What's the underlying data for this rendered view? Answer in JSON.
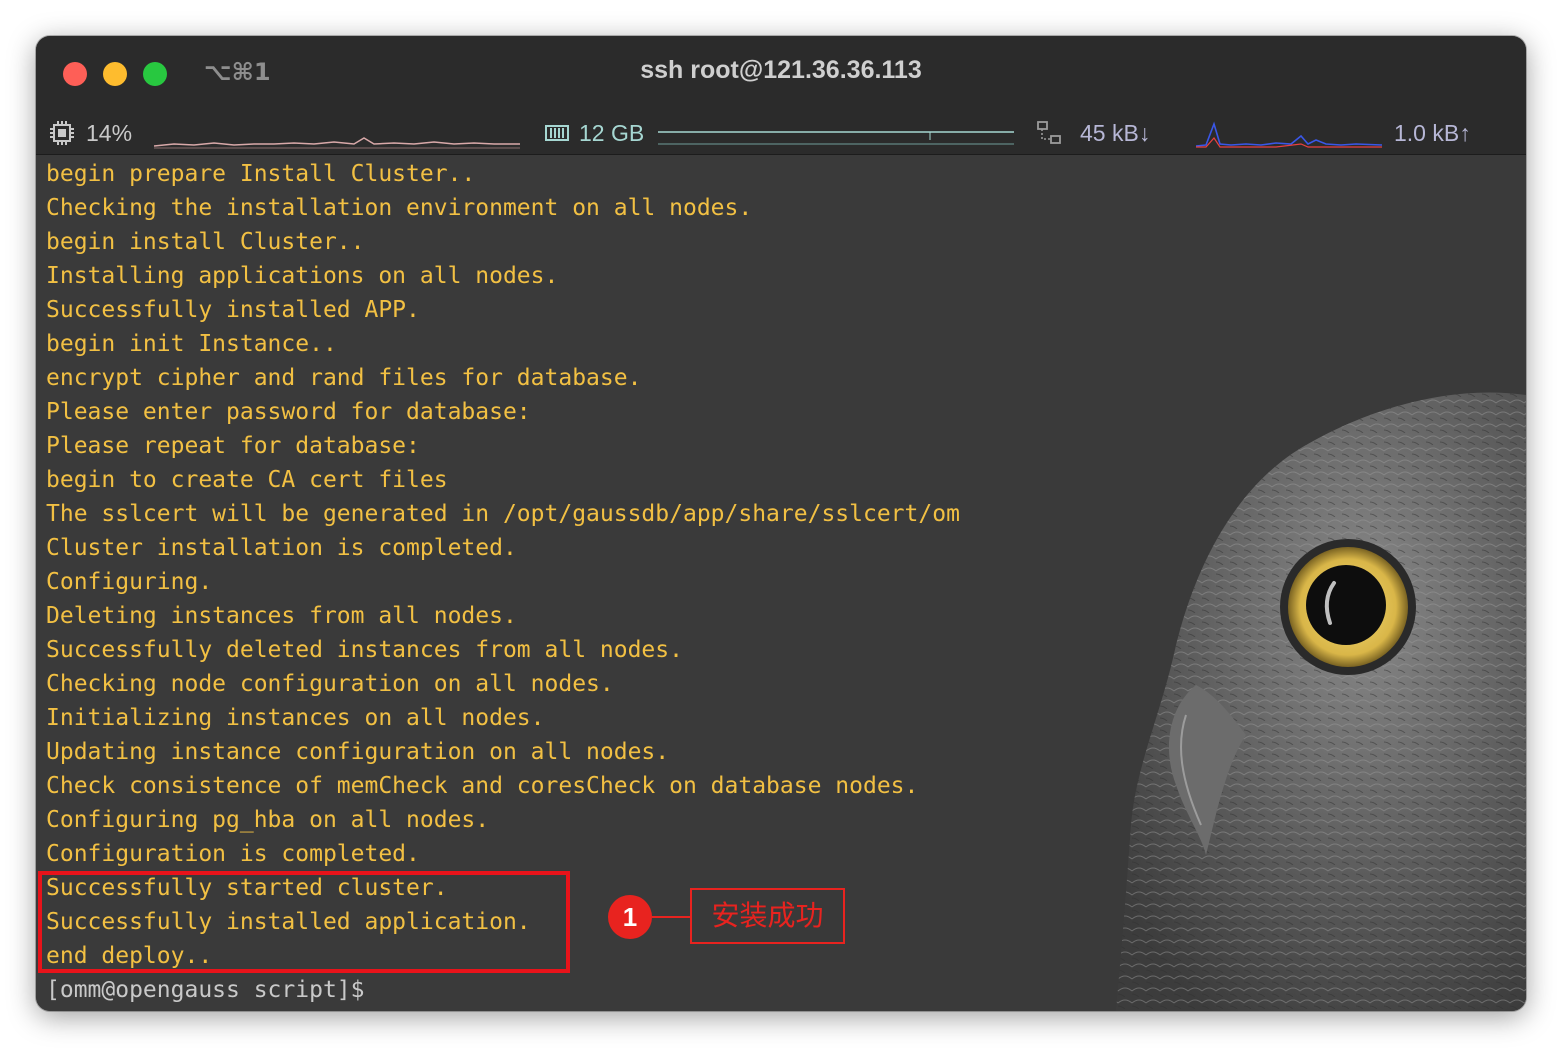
{
  "window": {
    "title": "ssh root@121.36.36.113",
    "shortcut": "⌥⌘1"
  },
  "status": {
    "cpu": "14%",
    "memory": "12 GB",
    "net_down": "45 kB↓",
    "net_up": "1.0 kB↑"
  },
  "terminal": {
    "lines": [
      "begin prepare Install Cluster..",
      "Checking the installation environment on all nodes.",
      "begin install Cluster..",
      "Installing applications on all nodes.",
      "Successfully installed APP.",
      "begin init Instance..",
      "encrypt cipher and rand files for database.",
      "Please enter password for database:",
      "Please repeat for database:",
      "begin to create CA cert files",
      "The sslcert will be generated in /opt/gaussdb/app/share/sslcert/om",
      "Cluster installation is completed.",
      "Configuring.",
      "Deleting instances from all nodes.",
      "Successfully deleted instances from all nodes.",
      "Checking node configuration on all nodes.",
      "Initializing instances on all nodes.",
      "Updating instance configuration on all nodes.",
      "Check consistence of memCheck and coresCheck on database nodes.",
      "Configuring pg_hba on all nodes.",
      "Configuration is completed.",
      "Successfully started cluster.",
      "Successfully installed application.",
      "end deploy.."
    ],
    "prompt": "[omm@opengauss script]$"
  },
  "annotation": {
    "badge": "1",
    "label": "安装成功"
  },
  "colors": {
    "output_text": "#f2c043",
    "prompt_text": "#c9c9c9",
    "annotation": "#e8231f",
    "cpu_text": "#c9c9c9",
    "mem_text": "#a6d7d2",
    "net_text": "#b7b7d6"
  },
  "icons": {
    "cpu": "cpu-chip-icon",
    "memory": "memory-icon",
    "network": "network-icon",
    "decor": "owl-illustration"
  }
}
